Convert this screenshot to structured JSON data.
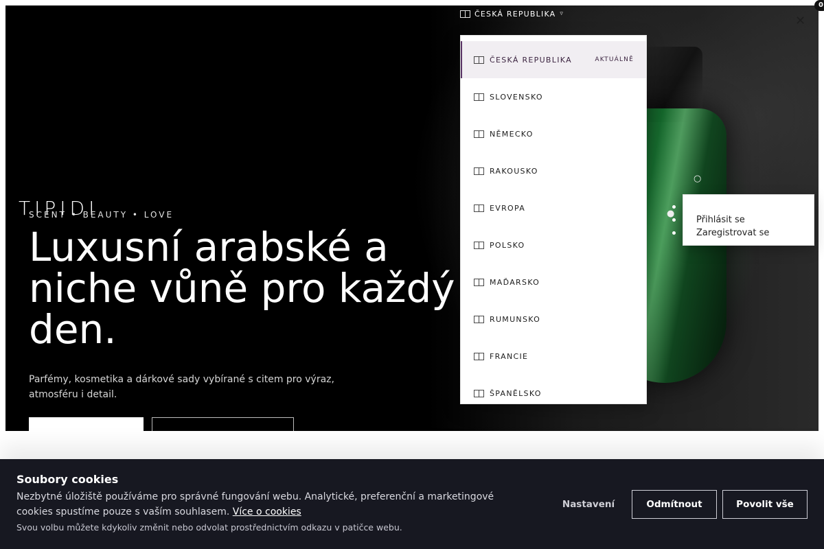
{
  "topbar": {
    "current_country": "ČESKÁ REPUBLIKA",
    "corner_badge": "0"
  },
  "hero": {
    "logo": "TIPIDI",
    "tagline": "SCENT • BEAUTY • LOVE",
    "headline": "Luxusní arabské a niche vůně pro každý den.",
    "subline": "Parfémy, kosmetika a dárkové sady vybírané s citem pro výraz, atmosféru i detail."
  },
  "country_menu": {
    "items": [
      {
        "label": "ČESKÁ REPUBLIKA",
        "badge": "AKTUÁLNĚ",
        "active": true
      },
      {
        "label": "SLOVENSKO",
        "badge": "",
        "active": false
      },
      {
        "label": "NĚMECKO",
        "badge": "",
        "active": false
      },
      {
        "label": "RAKOUSKO",
        "badge": "",
        "active": false
      },
      {
        "label": "EVROPA",
        "badge": "",
        "active": false
      },
      {
        "label": "POLSKO",
        "badge": "",
        "active": false
      },
      {
        "label": "MAĎARSKO",
        "badge": "",
        "active": false
      },
      {
        "label": "RUMUNSKO",
        "badge": "",
        "active": false
      },
      {
        "label": "FRANCIE",
        "badge": "",
        "active": false
      },
      {
        "label": "ŠPANĚLSKO",
        "badge": "",
        "active": false
      }
    ]
  },
  "account": {
    "login": "Přihlásit se",
    "register": "Zaregistrovat se"
  },
  "cookies": {
    "title": "Soubory cookies",
    "text": "Nezbytné úložiště používáme pro správné fungování webu. Analytické, preferenční a marketingové cookies spustíme pouze s vaším souhlasem.",
    "link": "Více o cookies",
    "note": "Svou volbu můžete kdykoliv změnit nebo odvolat prostřednictvím odkazu v patičce webu.",
    "settings_label": "Nastavení",
    "reject_label": "Odmítnout",
    "accept_label": "Povolit vše"
  },
  "colors": {
    "accent": "#5a3566",
    "banner_bg": "#171821",
    "active_row_bg": "#f1eef2"
  }
}
